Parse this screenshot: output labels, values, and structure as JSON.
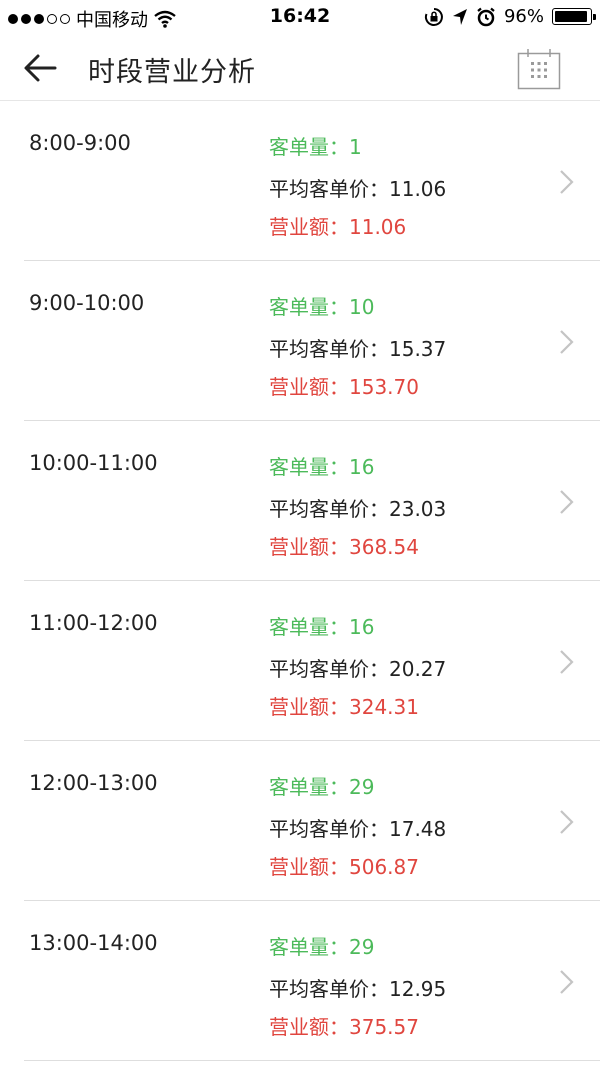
{
  "status_bar": {
    "carrier": "中国移动",
    "time": "16:42",
    "battery": "96%",
    "battery_level": 0.96
  },
  "header": {
    "title": "时段营业分析"
  },
  "rows": [
    {
      "time": "8:00-9:00",
      "orders": "客单量：1",
      "avg": "平均客单价：11.06",
      "revenue": "营业额：11.06"
    },
    {
      "time": "9:00-10:00",
      "orders": "客单量：10",
      "avg": "平均客单价：15.37",
      "revenue": "营业额：153.70"
    },
    {
      "time": "10:00-11:00",
      "orders": "客单量：16",
      "avg": "平均客单价：23.03",
      "revenue": "营业额：368.54"
    },
    {
      "time": "11:00-12:00",
      "orders": "客单量：16",
      "avg": "平均客单价：20.27",
      "revenue": "营业额：324.31"
    },
    {
      "time": "12:00-13:00",
      "orders": "客单量：29",
      "avg": "平均客单价：17.48",
      "revenue": "营业额：506.87"
    },
    {
      "time": "13:00-14:00",
      "orders": "客单量：29",
      "avg": "平均客单价：12.95",
      "revenue": "营业额：375.57"
    }
  ],
  "colors": {
    "orders": "#4cba5a",
    "revenue": "#e0463f",
    "divider": "#dedede"
  }
}
